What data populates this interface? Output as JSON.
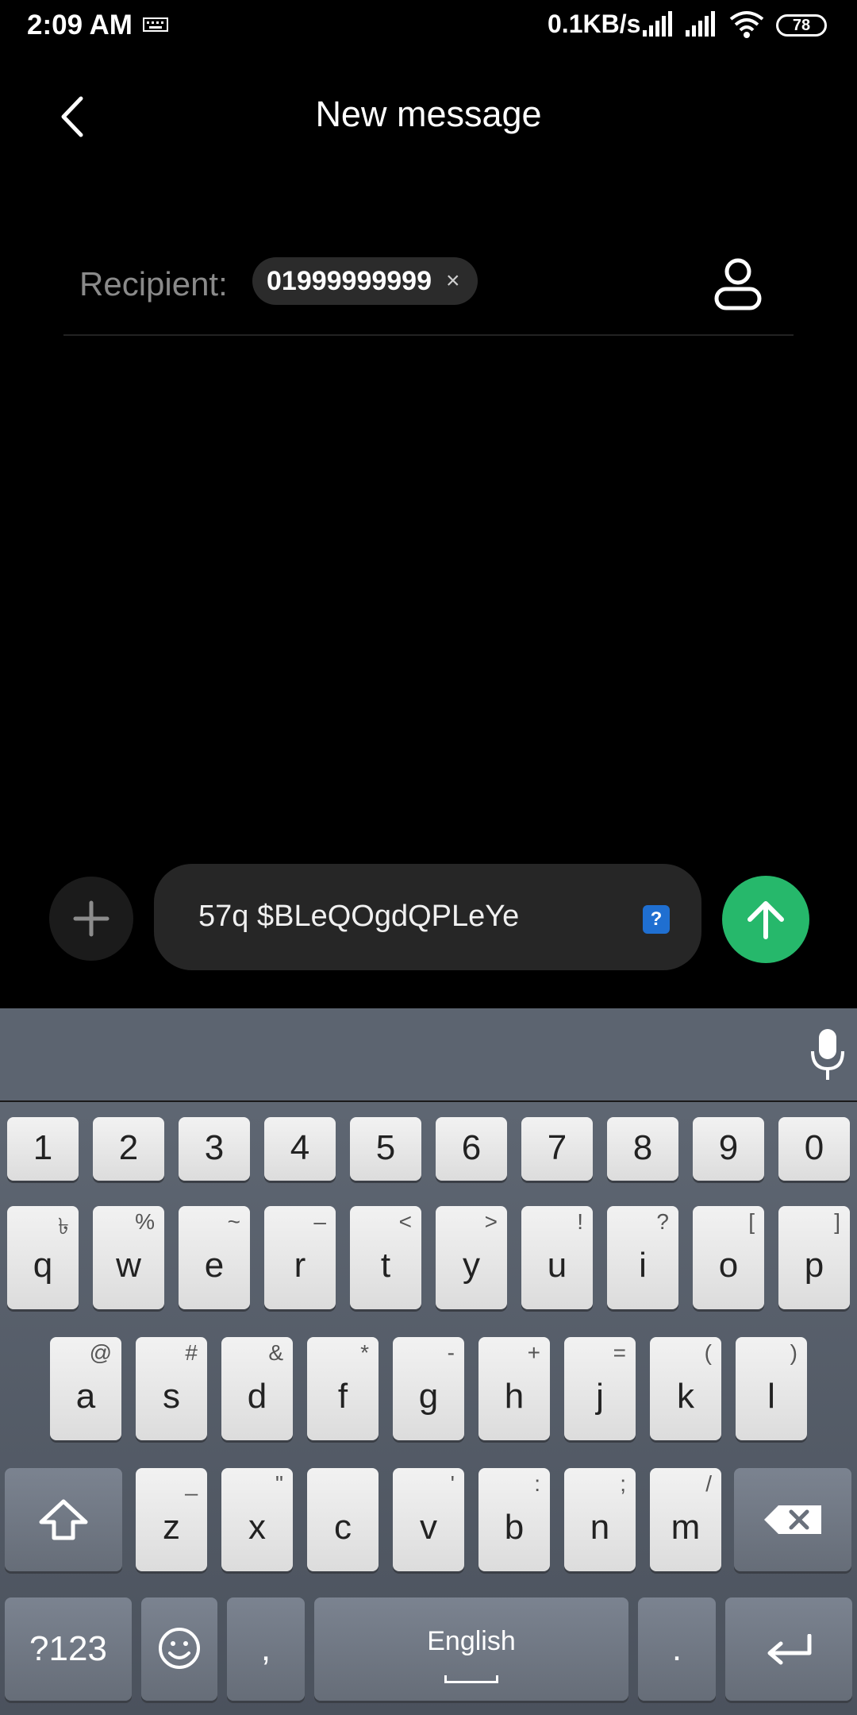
{
  "status_bar": {
    "time": "2:09 AM",
    "network_speed": "0.1KB/s",
    "battery": "78",
    "icons": [
      "keyboard-indicator-icon",
      "signal-icon",
      "signal-icon",
      "wifi-icon",
      "battery-icon"
    ]
  },
  "header": {
    "title": "New message",
    "back_icon": "chevron-left-icon"
  },
  "recipient": {
    "label": "Recipient:",
    "chip_number": "01999999999",
    "remove_glyph": "×",
    "contact_icon": "person-icon"
  },
  "compose": {
    "message_text": "57q $BLeQOgdQPLeYe",
    "sim_badge": "?",
    "attach_icon": "plus-icon",
    "send_icon": "arrow-up-icon",
    "send_color": "#26b86b"
  },
  "keyboard": {
    "numbers": [
      "1",
      "2",
      "3",
      "4",
      "5",
      "6",
      "7",
      "8",
      "9",
      "0"
    ],
    "row1": [
      {
        "k": "q",
        "s": "৳"
      },
      {
        "k": "w",
        "s": "%"
      },
      {
        "k": "e",
        "s": "~"
      },
      {
        "k": "r",
        "s": "–"
      },
      {
        "k": "t",
        "s": "<"
      },
      {
        "k": "y",
        "s": ">"
      },
      {
        "k": "u",
        "s": "!"
      },
      {
        "k": "i",
        "s": "?"
      },
      {
        "k": "o",
        "s": "["
      },
      {
        "k": "p",
        "s": "]"
      }
    ],
    "row2": [
      {
        "k": "a",
        "s": "@"
      },
      {
        "k": "s",
        "s": "#"
      },
      {
        "k": "d",
        "s": "&"
      },
      {
        "k": "f",
        "s": "*"
      },
      {
        "k": "g",
        "s": "-"
      },
      {
        "k": "h",
        "s": "+"
      },
      {
        "k": "j",
        "s": "="
      },
      {
        "k": "k",
        "s": "("
      },
      {
        "k": "l",
        "s": ")"
      }
    ],
    "row3": [
      {
        "k": "z",
        "s": "_"
      },
      {
        "k": "x",
        "s": "\""
      },
      {
        "k": "c",
        "s": ""
      },
      {
        "k": "v",
        "s": "'"
      },
      {
        "k": "b",
        "s": ":"
      },
      {
        "k": "n",
        "s": ";"
      },
      {
        "k": "m",
        "s": "/"
      }
    ],
    "symbols_label": "?123",
    "comma": ",",
    "space_label": "English",
    "period": ".",
    "mic_icon": "microphone-icon"
  }
}
